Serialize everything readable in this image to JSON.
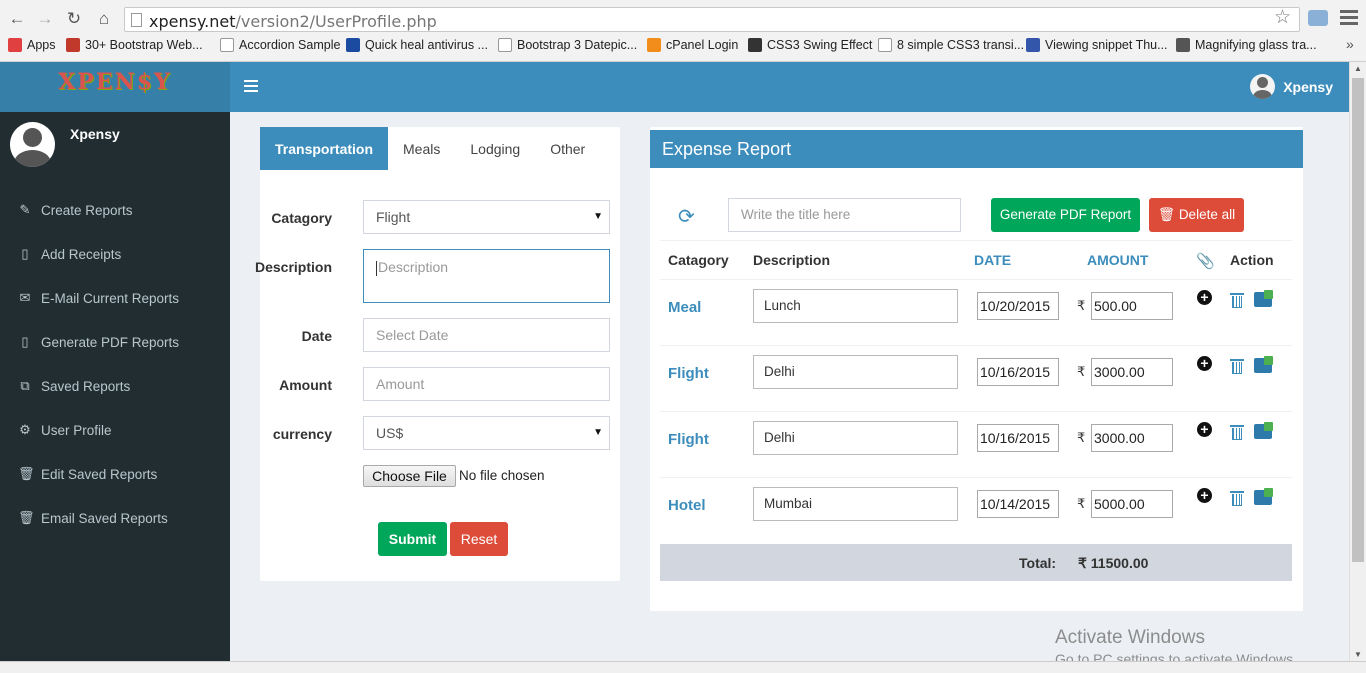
{
  "browser": {
    "url_host": "xpensy.net",
    "url_path": "/version2/UserProfile.php",
    "bookmarks": [
      {
        "label": "Apps",
        "color": "#e04040"
      },
      {
        "label": "30+ Bootstrap Web...",
        "color": "#c0392b"
      },
      {
        "label": "Accordion Sample",
        "color": "#ffffff"
      },
      {
        "label": "Quick heal antivirus ...",
        "color": "#1a4ba0"
      },
      {
        "label": "Bootstrap 3 Datepic...",
        "color": "#ffffff"
      },
      {
        "label": "cPanel Login",
        "color": "#f28c1a"
      },
      {
        "label": "CSS3 Swing Effect",
        "color": "#333333"
      },
      {
        "label": "8 simple CSS3 transi...",
        "color": "#ffffff"
      },
      {
        "label": "Viewing snippet Thu...",
        "color": "#3355aa"
      },
      {
        "label": "Magnifying glass tra...",
        "color": "#555555"
      }
    ]
  },
  "app": {
    "logo_text": "XPEN$Y",
    "user_name": "Xpensy",
    "accent": "#3c8dbc"
  },
  "sidebar": {
    "user_name": "Xpensy",
    "items": [
      {
        "label": "Create Reports",
        "icon": "edit-icon"
      },
      {
        "label": "Add Receipts",
        "icon": "file-icon"
      },
      {
        "label": "E-Mail Current Reports",
        "icon": "envelope-icon"
      },
      {
        "label": "Generate PDF Reports",
        "icon": "file-icon"
      },
      {
        "label": "Saved Reports",
        "icon": "copy-icon"
      },
      {
        "label": "User Profile",
        "icon": "gears-icon"
      },
      {
        "label": "Edit Saved Reports",
        "icon": "trash-icon"
      },
      {
        "label": "Email Saved Reports",
        "icon": "trash-icon"
      }
    ]
  },
  "form": {
    "tabs": [
      "Transportation",
      "Meals",
      "Lodging",
      "Other"
    ],
    "category_label": "Catagory",
    "category_value": "Flight",
    "description_label": "Description",
    "description_placeholder": "Description",
    "date_label": "Date",
    "date_placeholder": "Select Date",
    "amount_label": "Amount",
    "amount_placeholder": "Amount",
    "currency_label": "currency",
    "currency_value": "US$",
    "choose_file": "Choose File",
    "no_file": "No file chosen",
    "submit": "Submit",
    "reset": "Reset"
  },
  "report": {
    "title": "Expense Report",
    "title_placeholder": "Write the title here",
    "generate_pdf": "Generate PDF Report",
    "delete_all": "Delete all",
    "headers": {
      "category": "Catagory",
      "description": "Description",
      "date": "DATE",
      "amount": "AMOUNT",
      "action": "Action"
    },
    "currency_symbol": "₹",
    "rows": [
      {
        "category": "Meal",
        "description": "Lunch",
        "date": "10/20/2015",
        "amount": "500.00"
      },
      {
        "category": "Flight",
        "description": "Delhi",
        "date": "10/16/2015",
        "amount": "3000.00"
      },
      {
        "category": "Flight",
        "description": "Delhi",
        "date": "10/16/2015",
        "amount": "3000.00"
      },
      {
        "category": "Hotel",
        "description": "Mumbai",
        "date": "10/14/2015",
        "amount": "5000.00"
      }
    ],
    "total_label": "Total:",
    "total_value": "₹ 11500.00"
  },
  "watermark": {
    "line1": "Activate Windows",
    "line2": "Go to PC settings to activate Windows."
  }
}
